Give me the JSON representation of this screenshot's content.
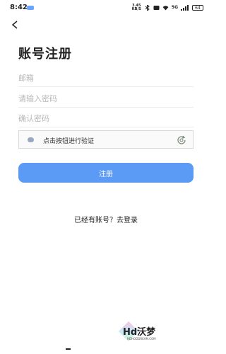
{
  "status_bar": {
    "time": "8:42",
    "speed_value": "3.45",
    "speed_unit": "KB/S",
    "network": "5G",
    "battery": "64"
  },
  "header": {
    "title": "账号注册"
  },
  "form": {
    "email_placeholder": "邮箱",
    "password_placeholder": "请输入密码",
    "confirm_password_placeholder": "确认密码"
  },
  "verify": {
    "label": "点击按钮进行验证"
  },
  "actions": {
    "register_label": "注册",
    "login_link": "已经有账号？去登录"
  },
  "watermark": {
    "text": "Hd沃梦",
    "subtext": "HDHOODREAM.COM"
  },
  "colors": {
    "accent": "#5b9af5"
  }
}
